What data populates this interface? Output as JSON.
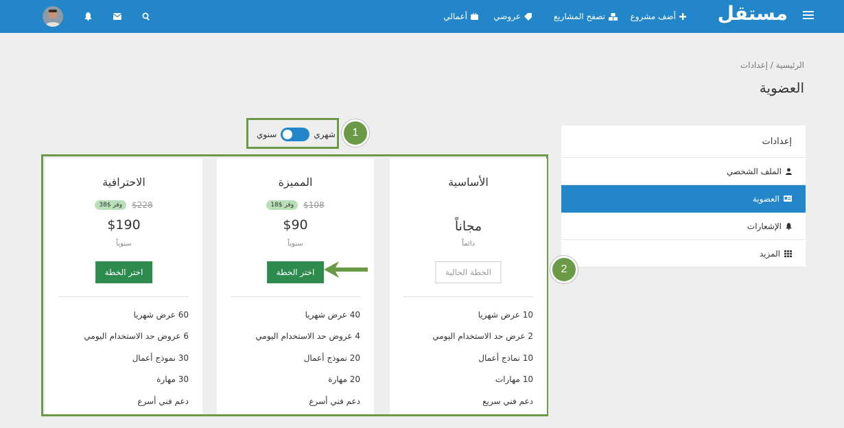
{
  "nav": {
    "logo": "مستقل",
    "links": [
      {
        "label": "أضف مشروع",
        "icon": "plus-icon"
      },
      {
        "label": "تصفح المشاريع",
        "icon": "cubes-icon"
      },
      {
        "label": "عروضي",
        "icon": "tag-icon"
      },
      {
        "label": "أعمالي",
        "icon": "briefcase-icon"
      }
    ]
  },
  "breadcrumb": {
    "home": "الرئيسية",
    "separator": "/",
    "current": "إعدادات"
  },
  "page_title": "العضوية",
  "sidebar": {
    "header": "إعدادات",
    "items": [
      {
        "label": "الملف الشخصي",
        "icon": "user-icon"
      },
      {
        "label": "العضوية",
        "icon": "id-card-icon",
        "active": true
      },
      {
        "label": "الإشعارات",
        "icon": "bell-icon"
      },
      {
        "label": "المزيد",
        "icon": "grid-icon"
      }
    ]
  },
  "billing_toggle": {
    "monthly": "شهري",
    "yearly": "سنوي"
  },
  "callouts": [
    "1",
    "2"
  ],
  "plans": [
    {
      "name": "الأساسية",
      "price": "مجاناً",
      "period": "دائماً",
      "button": "الخطة الحالية",
      "features": [
        "10 عرض شهريا",
        "2 عرض حد الاستخدام اليومي",
        "10 نماذج أعمال",
        "10 مهارات",
        "دعم فني سريع"
      ]
    },
    {
      "name": "المميزة",
      "old_price": "$108",
      "save": "وفر $18",
      "price": "$90",
      "period": "سنوياً",
      "button": "اختر الخطة",
      "features": [
        "40 عرض شهريا",
        "4 عروض حد الاستخدام اليومي",
        "20 نموذج أعمال",
        "20 مهارة",
        "دعم فني أسرع"
      ]
    },
    {
      "name": "الاحترافية",
      "old_price": "$228",
      "save": "وفر $38",
      "price": "$190",
      "period": "سنوياً",
      "button": "اختر الخطة",
      "features": [
        "60 عرض شهريا",
        "6 عروض حد الاستخدام اليومي",
        "30 نموذج أعمال",
        "30 مهارة",
        "دعم فني أسرع"
      ]
    }
  ],
  "colors": {
    "brand": "#2386c8",
    "choose_button": "#2e8b4e",
    "callout": "#6a9a45",
    "save_badge": "#b9dfb9"
  }
}
